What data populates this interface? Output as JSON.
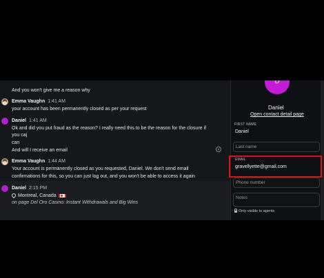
{
  "chat": {
    "messages": [
      {
        "text": "And you won't give me a reason why"
      },
      {
        "author": "Emma Vaughn",
        "time": "1:41 AM",
        "lines": [
          "your account has been permanently closed as per your request"
        ]
      },
      {
        "author": "Daniel",
        "time": "1:41 AM",
        "lines": [
          "Ok and did you put fraud as the reason? I really need this to be the reason for the closure if",
          "you caj",
          "can",
          "And will I receive an email"
        ]
      },
      {
        "author": "Emma Vaughn",
        "time": "1:44 AM",
        "lines": [
          "Your account is permanently closed as you requested, Daniel. We don't send email",
          "confirmations for this, so you can just log out, and you won't be able to access it again"
        ]
      },
      {
        "author": "Daniel",
        "time": "2:15 PM",
        "location": "Montreal, Canada",
        "page": "on page Del Oro Casino: Instant Withdrawals and Big Wins"
      }
    ]
  },
  "contact": {
    "avatar_letter": "D",
    "name": "Daniel",
    "detail_link": "Open contact detail page",
    "first_name_label": "FIRST NAME",
    "first_name_value": "Daniel",
    "last_name_placeholder": "Last name",
    "email_label": "EMAIL",
    "email_value": "gravellyette@gmail.com",
    "phone_placeholder": "Phone number",
    "notes_placeholder": "Notes",
    "visibility": "Only visible to agents"
  },
  "colors": {
    "highlight_box": "#e01010",
    "avatar": "#c31bd8"
  }
}
